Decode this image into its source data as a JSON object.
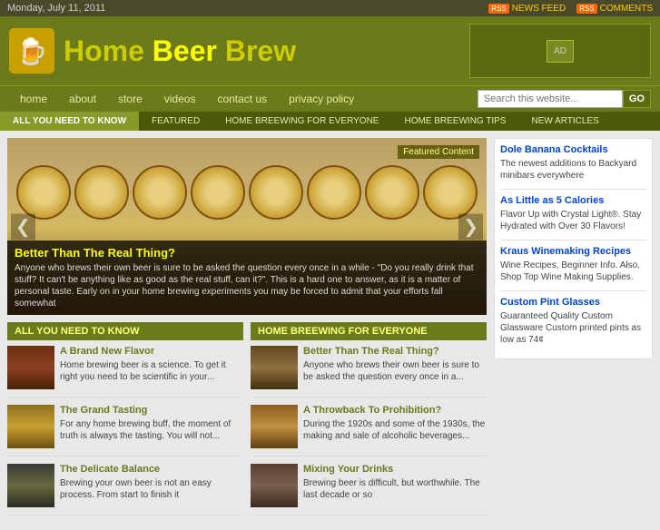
{
  "topbar": {
    "date": "Monday, July 11, 2011",
    "newsfeed_label": "NEWS FEED",
    "comments_label": "COMMENTS"
  },
  "header": {
    "logo_home": "Home",
    "logo_beer": "Beer",
    "logo_brew": "Brew",
    "logo_icon": "🍺"
  },
  "nav": {
    "items": [
      "home",
      "about",
      "store",
      "videos",
      "contact us",
      "privacy policy"
    ],
    "search_placeholder": "Search this website...",
    "search_btn": "GO"
  },
  "catbar": {
    "items": [
      "ALL YOU NEED TO KNOW",
      "FEATURED",
      "HOME BREEWING FOR EVERYONE",
      "HOME BREEWING TIPS",
      "NEW ARTICLES"
    ]
  },
  "featured": {
    "tag": "Featured Content",
    "title": "Better Than The Real Thing?",
    "excerpt": "Anyone who brews their own beer is sure to be asked the question every once in a while - \"Do you really drink that stuff? It can't be anything like as good as the real stuff, can it?\". This is a hard one to answer, as it is a matter of personal taste. Early on in your home brewing experiments you may be forced to admit that your efforts fall somewhat"
  },
  "col1": {
    "header": "ALL YOU NEED TO KNOW",
    "articles": [
      {
        "title": "A Brand New Flavor",
        "excerpt": "Home brewing beer is a science. To get it right you need to be scientific in your..."
      },
      {
        "title": "The Grand Tasting",
        "excerpt": "For any home brewing buff, the moment of truth is always the tasting. You will not..."
      },
      {
        "title": "The Delicate Balance",
        "excerpt": "Brewing your own beer is not an easy process. From start to finish it"
      }
    ]
  },
  "col2": {
    "header": "HOME BREEWING FOR EVERYONE",
    "articles": [
      {
        "title": "Better Than The Real Thing?",
        "excerpt": "Anyone who brews their own beer is sure to be asked the question every once in a..."
      },
      {
        "title": "A Throwback To Prohibition?",
        "excerpt": "During the 1920s and some of the 1930s, the making and sale of alcoholic beverages..."
      },
      {
        "title": "Mixing Your Drinks",
        "excerpt": "Brewing beer is difficult, but worthwhile. The last decade or so"
      }
    ]
  },
  "sidebar": {
    "ads": [
      {
        "title": "Dole Banana Cocktails",
        "text": "The newest additions to Backyard minibars everywhere"
      },
      {
        "title": "As Little as 5 Calories",
        "text": "Flavor Up with Crystal Light®. Stay Hydrated with Over 30 Flavors!"
      },
      {
        "title": "Kraus Winemaking Recipes",
        "text": "Wine Recipes, Beginner Info. Also, Shop Top Wine Making Supplies."
      },
      {
        "title": "Custom Pint Glasses",
        "text": "Guaranteed Quality Custom Glassware Custom printed pints as low as 74¢"
      }
    ]
  }
}
